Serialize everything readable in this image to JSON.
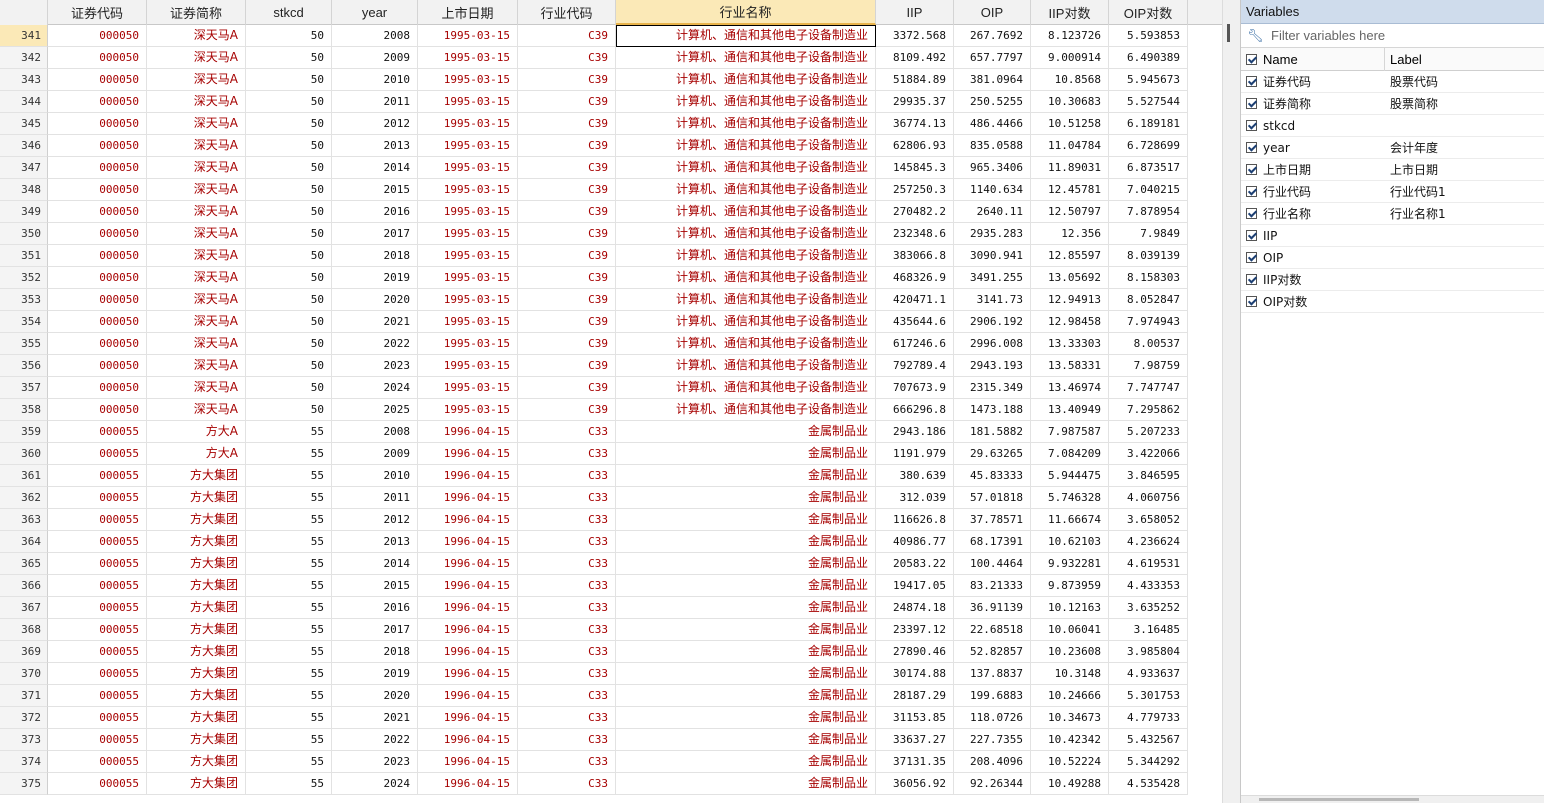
{
  "columns": [
    {
      "key": "rownum",
      "label": "",
      "width": 48
    },
    {
      "key": "code",
      "label": "证券代码",
      "width": 99,
      "type": "str"
    },
    {
      "key": "short",
      "label": "证券简称",
      "width": 99,
      "type": "strcjk"
    },
    {
      "key": "stkcd",
      "label": "stkcd",
      "width": 86,
      "type": "num"
    },
    {
      "key": "year",
      "label": "year",
      "width": 86,
      "type": "num"
    },
    {
      "key": "list_date",
      "label": "上市日期",
      "width": 100,
      "type": "str"
    },
    {
      "key": "ind_code",
      "label": "行业代码",
      "width": 98,
      "type": "str"
    },
    {
      "key": "ind_name",
      "label": "行业名称",
      "width": 260,
      "type": "strcjk"
    },
    {
      "key": "iip",
      "label": "IIP",
      "width": 78,
      "type": "num"
    },
    {
      "key": "oip",
      "label": "OIP",
      "width": 77,
      "type": "num"
    },
    {
      "key": "iip_log",
      "label": "IIP对数",
      "width": 78,
      "type": "num"
    },
    {
      "key": "oip_log",
      "label": "OIP对数",
      "width": 79,
      "type": "num"
    }
  ],
  "grid": {
    "selected_column": "ind_name",
    "active_row": "341",
    "rows": [
      [
        "341",
        "000050",
        "深天马A",
        "50",
        "2008",
        "1995-03-15",
        "C39",
        "计算机、通信和其他电子设备制造业",
        "3372.568",
        "267.7692",
        "8.123726",
        "5.593853"
      ],
      [
        "342",
        "000050",
        "深天马A",
        "50",
        "2009",
        "1995-03-15",
        "C39",
        "计算机、通信和其他电子设备制造业",
        "8109.492",
        "657.7797",
        "9.000914",
        "6.490389"
      ],
      [
        "343",
        "000050",
        "深天马A",
        "50",
        "2010",
        "1995-03-15",
        "C39",
        "计算机、通信和其他电子设备制造业",
        "51884.89",
        "381.0964",
        "10.8568",
        "5.945673"
      ],
      [
        "344",
        "000050",
        "深天马A",
        "50",
        "2011",
        "1995-03-15",
        "C39",
        "计算机、通信和其他电子设备制造业",
        "29935.37",
        "250.5255",
        "10.30683",
        "5.527544"
      ],
      [
        "345",
        "000050",
        "深天马A",
        "50",
        "2012",
        "1995-03-15",
        "C39",
        "计算机、通信和其他电子设备制造业",
        "36774.13",
        "486.4466",
        "10.51258",
        "6.189181"
      ],
      [
        "346",
        "000050",
        "深天马A",
        "50",
        "2013",
        "1995-03-15",
        "C39",
        "计算机、通信和其他电子设备制造业",
        "62806.93",
        "835.0588",
        "11.04784",
        "6.728699"
      ],
      [
        "347",
        "000050",
        "深天马A",
        "50",
        "2014",
        "1995-03-15",
        "C39",
        "计算机、通信和其他电子设备制造业",
        "145845.3",
        "965.3406",
        "11.89031",
        "6.873517"
      ],
      [
        "348",
        "000050",
        "深天马A",
        "50",
        "2015",
        "1995-03-15",
        "C39",
        "计算机、通信和其他电子设备制造业",
        "257250.3",
        "1140.634",
        "12.45781",
        "7.040215"
      ],
      [
        "349",
        "000050",
        "深天马A",
        "50",
        "2016",
        "1995-03-15",
        "C39",
        "计算机、通信和其他电子设备制造业",
        "270482.2",
        "2640.11",
        "12.50797",
        "7.878954"
      ],
      [
        "350",
        "000050",
        "深天马A",
        "50",
        "2017",
        "1995-03-15",
        "C39",
        "计算机、通信和其他电子设备制造业",
        "232348.6",
        "2935.283",
        "12.356",
        "7.9849"
      ],
      [
        "351",
        "000050",
        "深天马A",
        "50",
        "2018",
        "1995-03-15",
        "C39",
        "计算机、通信和其他电子设备制造业",
        "383066.8",
        "3090.941",
        "12.85597",
        "8.039139"
      ],
      [
        "352",
        "000050",
        "深天马A",
        "50",
        "2019",
        "1995-03-15",
        "C39",
        "计算机、通信和其他电子设备制造业",
        "468326.9",
        "3491.255",
        "13.05692",
        "8.158303"
      ],
      [
        "353",
        "000050",
        "深天马A",
        "50",
        "2020",
        "1995-03-15",
        "C39",
        "计算机、通信和其他电子设备制造业",
        "420471.1",
        "3141.73",
        "12.94913",
        "8.052847"
      ],
      [
        "354",
        "000050",
        "深天马A",
        "50",
        "2021",
        "1995-03-15",
        "C39",
        "计算机、通信和其他电子设备制造业",
        "435644.6",
        "2906.192",
        "12.98458",
        "7.974943"
      ],
      [
        "355",
        "000050",
        "深天马A",
        "50",
        "2022",
        "1995-03-15",
        "C39",
        "计算机、通信和其他电子设备制造业",
        "617246.6",
        "2996.008",
        "13.33303",
        "8.00537"
      ],
      [
        "356",
        "000050",
        "深天马A",
        "50",
        "2023",
        "1995-03-15",
        "C39",
        "计算机、通信和其他电子设备制造业",
        "792789.4",
        "2943.193",
        "13.58331",
        "7.98759"
      ],
      [
        "357",
        "000050",
        "深天马A",
        "50",
        "2024",
        "1995-03-15",
        "C39",
        "计算机、通信和其他电子设备制造业",
        "707673.9",
        "2315.349",
        "13.46974",
        "7.747747"
      ],
      [
        "358",
        "000050",
        "深天马A",
        "50",
        "2025",
        "1995-03-15",
        "C39",
        "计算机、通信和其他电子设备制造业",
        "666296.8",
        "1473.188",
        "13.40949",
        "7.295862"
      ],
      [
        "359",
        "000055",
        "方大A",
        "55",
        "2008",
        "1996-04-15",
        "C33",
        "金属制品业",
        "2943.186",
        "181.5882",
        "7.987587",
        "5.207233"
      ],
      [
        "360",
        "000055",
        "方大A",
        "55",
        "2009",
        "1996-04-15",
        "C33",
        "金属制品业",
        "1191.979",
        "29.63265",
        "7.084209",
        "3.422066"
      ],
      [
        "361",
        "000055",
        "方大集团",
        "55",
        "2010",
        "1996-04-15",
        "C33",
        "金属制品业",
        "380.639",
        "45.83333",
        "5.944475",
        "3.846595"
      ],
      [
        "362",
        "000055",
        "方大集团",
        "55",
        "2011",
        "1996-04-15",
        "C33",
        "金属制品业",
        "312.039",
        "57.01818",
        "5.746328",
        "4.060756"
      ],
      [
        "363",
        "000055",
        "方大集团",
        "55",
        "2012",
        "1996-04-15",
        "C33",
        "金属制品业",
        "116626.8",
        "37.78571",
        "11.66674",
        "3.658052"
      ],
      [
        "364",
        "000055",
        "方大集团",
        "55",
        "2013",
        "1996-04-15",
        "C33",
        "金属制品业",
        "40986.77",
        "68.17391",
        "10.62103",
        "4.236624"
      ],
      [
        "365",
        "000055",
        "方大集团",
        "55",
        "2014",
        "1996-04-15",
        "C33",
        "金属制品业",
        "20583.22",
        "100.4464",
        "9.932281",
        "4.619531"
      ],
      [
        "366",
        "000055",
        "方大集团",
        "55",
        "2015",
        "1996-04-15",
        "C33",
        "金属制品业",
        "19417.05",
        "83.21333",
        "9.873959",
        "4.433353"
      ],
      [
        "367",
        "000055",
        "方大集团",
        "55",
        "2016",
        "1996-04-15",
        "C33",
        "金属制品业",
        "24874.18",
        "36.91139",
        "10.12163",
        "3.635252"
      ],
      [
        "368",
        "000055",
        "方大集团",
        "55",
        "2017",
        "1996-04-15",
        "C33",
        "金属制品业",
        "23397.12",
        "22.68518",
        "10.06041",
        "3.16485"
      ],
      [
        "369",
        "000055",
        "方大集团",
        "55",
        "2018",
        "1996-04-15",
        "C33",
        "金属制品业",
        "27890.46",
        "52.82857",
        "10.23608",
        "3.985804"
      ],
      [
        "370",
        "000055",
        "方大集团",
        "55",
        "2019",
        "1996-04-15",
        "C33",
        "金属制品业",
        "30174.88",
        "137.8837",
        "10.3148",
        "4.933637"
      ],
      [
        "371",
        "000055",
        "方大集团",
        "55",
        "2020",
        "1996-04-15",
        "C33",
        "金属制品业",
        "28187.29",
        "199.6883",
        "10.24666",
        "5.301753"
      ],
      [
        "372",
        "000055",
        "方大集团",
        "55",
        "2021",
        "1996-04-15",
        "C33",
        "金属制品业",
        "31153.85",
        "118.0726",
        "10.34673",
        "4.779733"
      ],
      [
        "373",
        "000055",
        "方大集团",
        "55",
        "2022",
        "1996-04-15",
        "C33",
        "金属制品业",
        "33637.27",
        "227.7355",
        "10.42342",
        "5.432567"
      ],
      [
        "374",
        "000055",
        "方大集团",
        "55",
        "2023",
        "1996-04-15",
        "C33",
        "金属制品业",
        "37131.35",
        "208.4096",
        "10.52224",
        "5.344292"
      ],
      [
        "375",
        "000055",
        "方大集团",
        "55",
        "2024",
        "1996-04-15",
        "C33",
        "金属制品业",
        "36056.92",
        "92.26344",
        "10.49288",
        "4.535428"
      ]
    ]
  },
  "variables_panel": {
    "title": "Variables",
    "filter_placeholder": "Filter variables here",
    "filter_icon": "wrench-icon",
    "header": {
      "name": "Name",
      "label": "Label"
    },
    "items": [
      {
        "name": "证券代码",
        "label": "股票代码"
      },
      {
        "name": "证券简称",
        "label": "股票简称"
      },
      {
        "name": "stkcd",
        "label": ""
      },
      {
        "name": "year",
        "label": "会计年度"
      },
      {
        "name": "上市日期",
        "label": "上市日期"
      },
      {
        "name": "行业代码",
        "label": "行业代码1"
      },
      {
        "name": "行业名称",
        "label": "行业名称1"
      },
      {
        "name": "IIP",
        "label": ""
      },
      {
        "name": "OIP",
        "label": ""
      },
      {
        "name": "IIP对数",
        "label": ""
      },
      {
        "name": "OIP对数",
        "label": ""
      }
    ]
  },
  "colors": {
    "string_text": "#a60000",
    "selection_highlight": "#fbe9b7",
    "panel_title_bg": "#cfdcec"
  }
}
